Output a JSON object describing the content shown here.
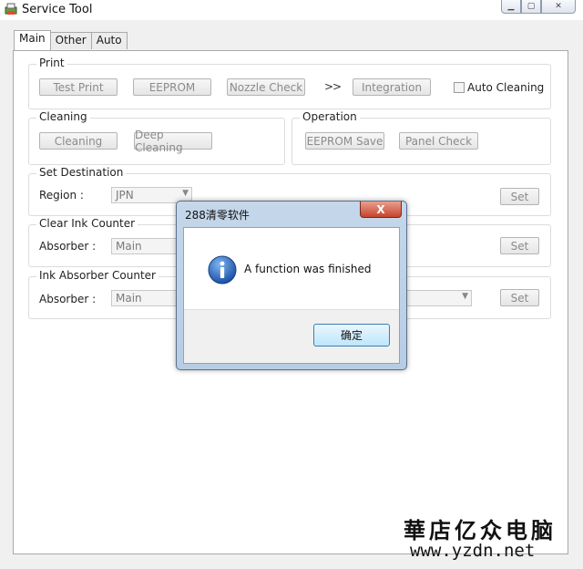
{
  "window": {
    "title": "Service Tool",
    "controls": [
      "minimize",
      "maximize",
      "close"
    ]
  },
  "tabs": [
    {
      "label": "Main",
      "active": true
    },
    {
      "label": "Other",
      "active": false
    },
    {
      "label": "Auto",
      "active": false
    }
  ],
  "print": {
    "label": "Print",
    "test_print": "Test Print",
    "eeprom": "EEPROM",
    "nozzle_check": "Nozzle Check",
    "arrows": ">>",
    "integration": "Integration",
    "auto_cleaning": "Auto Cleaning"
  },
  "cleaning": {
    "label": "Cleaning",
    "cleaning": "Cleaning",
    "deep_cleaning": "Deep Cleaning"
  },
  "operation": {
    "label": "Operation",
    "eeprom_save": "EEPROM Save",
    "panel_check": "Panel Check"
  },
  "set_destination": {
    "label": "Set Destination",
    "region_label": "Region :",
    "region_value": "JPN",
    "set": "Set"
  },
  "clear_ink_counter": {
    "label": "Clear Ink Counter",
    "absorber_label": "Absorber :",
    "absorber_value": "Main",
    "set": "Set"
  },
  "ink_absorber_counter": {
    "label": "Ink Absorber Counter",
    "absorber_label": "Absorber :",
    "absorber_value": "Main",
    "set": "Set"
  },
  "dialog": {
    "title": "288清零软件",
    "message": "A function was finished",
    "ok": "确定",
    "close_glyph": "X"
  },
  "watermark": {
    "text": "華店亿众电脑",
    "url": "www.yzdn.net"
  }
}
